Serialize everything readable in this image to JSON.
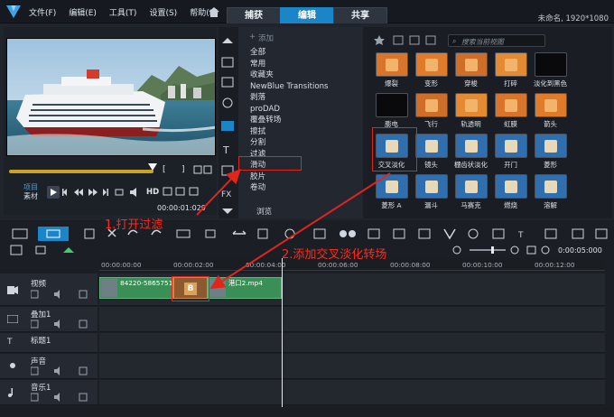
{
  "app": {
    "menu": [
      "文件(F)",
      "编辑(E)",
      "工具(T)",
      "设置(S)",
      "帮助(H)"
    ],
    "mode_tabs": [
      "捕获",
      "编辑",
      "共享"
    ],
    "active_tab": "编辑",
    "project_info": "未命名, 1920*1080"
  },
  "player": {
    "in_marker": "[",
    "out_marker": "]",
    "project_label": "项目",
    "clip_label": "素材",
    "hd_label": "HD",
    "timecode": "00:00:01:029"
  },
  "library": {
    "add_label": "添加",
    "search_placeholder": "搜索当前视图",
    "browse_label": "浏览",
    "categories": [
      "全部",
      "常用",
      "收藏夹",
      "NewBlue Transitions",
      "剥落",
      "proDAD",
      "覆叠转场",
      "擦拭",
      "分割",
      "过滤",
      "滑动",
      "胶片",
      "卷动"
    ],
    "selected_category": "过滤",
    "transitions": [
      "爆裂",
      "变形",
      "穿梭",
      "打碎",
      "淡化到黑色",
      "膨电",
      "飞行",
      "轨透明",
      "虹膜",
      "箭头",
      "交叉淡化",
      "镜头",
      "棚齿状淡化",
      "开门",
      "菱形",
      "菱形 A",
      "漏斗",
      "马赛克",
      "燃烧",
      "溶解"
    ],
    "selected_transition": "交叉淡化"
  },
  "timeline": {
    "ruler_ticks": [
      "00:00:00:00",
      "00:00:02:00",
      "00:00:04:00",
      "00:00:06:00",
      "00:00:08:00",
      "00:00:10:00",
      "00:00:12:00"
    ],
    "duration": "0:00:05:000",
    "tracks": [
      "视频",
      "叠加1",
      "标题1",
      "声音",
      "音乐1"
    ],
    "clips": [
      {
        "name": "84220-5865751",
        "track": "视频"
      },
      {
        "name": "港口2.mp4",
        "track": "视频"
      }
    ]
  },
  "annotations": {
    "step1": "1.打开过滤",
    "step2": "2.添加交叉淡化转场"
  },
  "colors": {
    "accent": "#1a86c8",
    "annotation_red": "#e0251d",
    "clip_green": "#3a8f56"
  }
}
